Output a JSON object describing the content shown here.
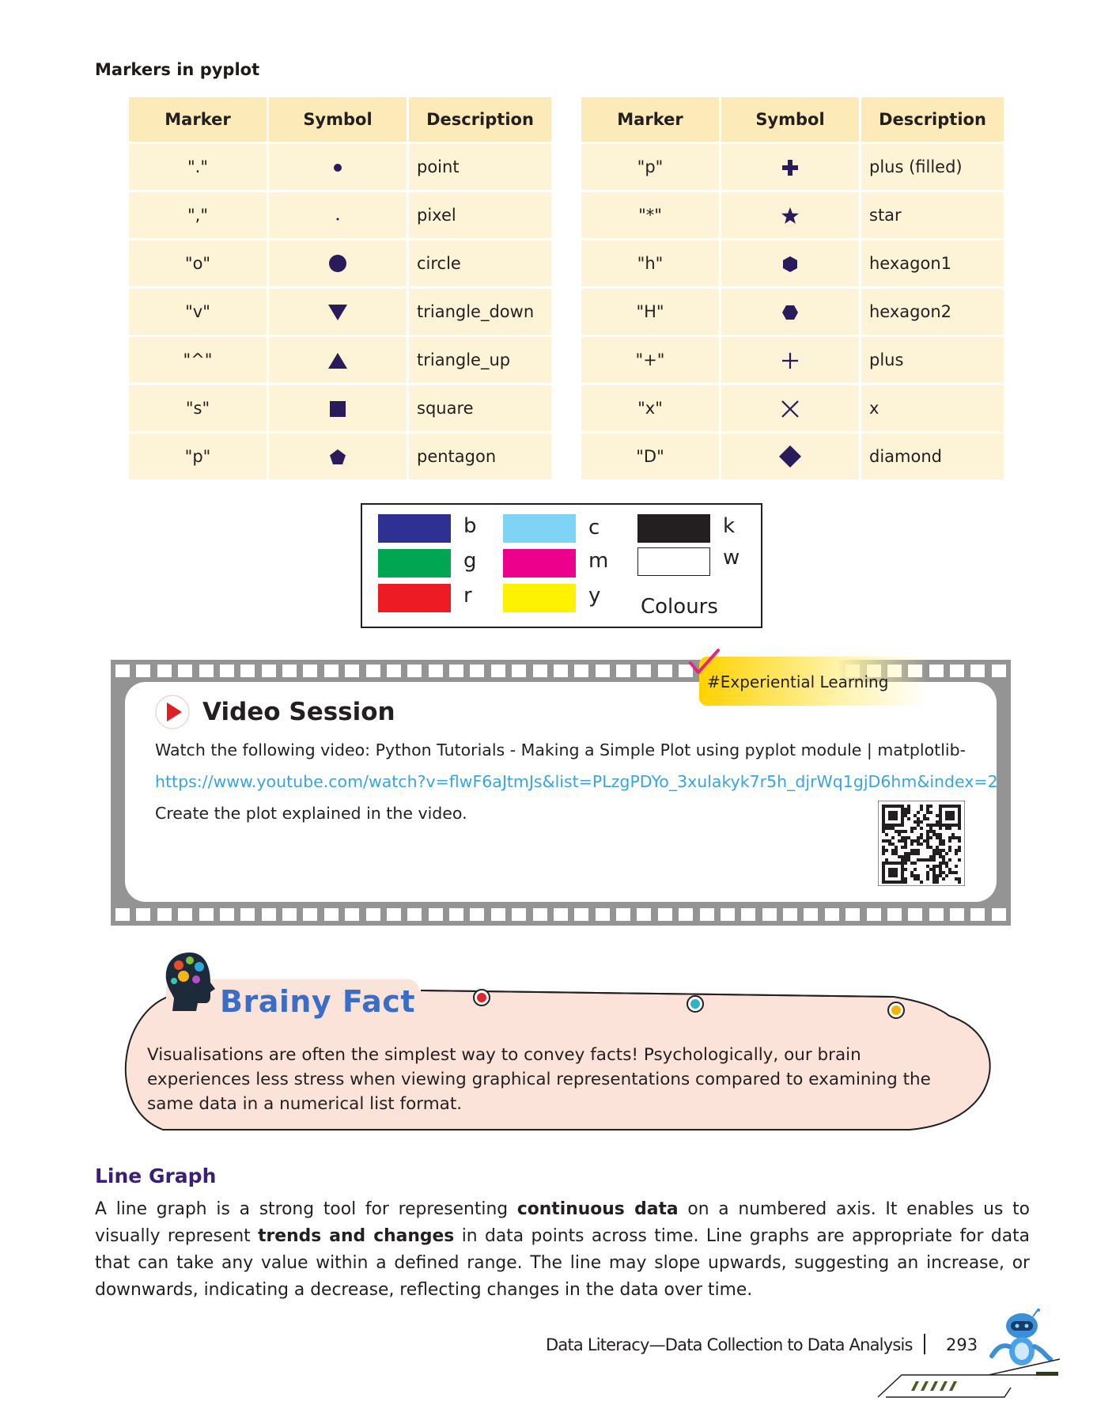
{
  "section_title": "Markers in pyplot",
  "table_headers": {
    "marker": "Marker",
    "symbol": "Symbol",
    "description": "Description"
  },
  "left_table": [
    {
      "marker": "\".\"",
      "symbol": "point-icon",
      "description": "point"
    },
    {
      "marker": "\",\"",
      "symbol": "pixel-icon",
      "description": "pixel"
    },
    {
      "marker": "\"o\"",
      "symbol": "circle-icon",
      "description": "circle"
    },
    {
      "marker": "\"v\"",
      "symbol": "triangle-down-icon",
      "description": "triangle_down"
    },
    {
      "marker": "\"^\"",
      "symbol": "triangle-up-icon",
      "description": "triangle_up"
    },
    {
      "marker": "\"s\"",
      "symbol": "square-icon",
      "description": "square"
    },
    {
      "marker": "\"p\"",
      "symbol": "pentagon-icon",
      "description": "pentagon"
    }
  ],
  "right_table": [
    {
      "marker": "\"p\"",
      "symbol": "plus-filled-icon",
      "description": "plus (filled)"
    },
    {
      "marker": "\"*\"",
      "symbol": "star-icon",
      "description": "star"
    },
    {
      "marker": "\"h\"",
      "symbol": "hexagon1-icon",
      "description": "hexagon1"
    },
    {
      "marker": "\"H\"",
      "symbol": "hexagon2-icon",
      "description": "hexagon2"
    },
    {
      "marker": "\"+\"",
      "symbol": "plus-icon",
      "description": "plus"
    },
    {
      "marker": "\"x\"",
      "symbol": "x-icon",
      "description": "x"
    },
    {
      "marker": "\"D\"",
      "symbol": "diamond-icon",
      "description": "diamond"
    }
  ],
  "colours": {
    "caption": "Colours",
    "items": [
      {
        "code": "b",
        "hex": "#2e3192"
      },
      {
        "code": "g",
        "hex": "#00a651"
      },
      {
        "code": "r",
        "hex": "#ed1c24"
      },
      {
        "code": "c",
        "hex": "#7fd4f5"
      },
      {
        "code": "m",
        "hex": "#ec008c"
      },
      {
        "code": "y",
        "hex": "#fff200"
      },
      {
        "code": "k",
        "hex": "#231f20"
      },
      {
        "code": "w",
        "hex": "#ffffff"
      }
    ]
  },
  "video": {
    "tag": "#Experiential Learning",
    "title": "Video Session",
    "line1": "Watch the following video: Python Tutorials - Making a Simple Plot using pyplot module | matplotlib-",
    "link": "https://www.youtube.com/watch?v=flwF6aJtmJs&list=PLzgPDYo_3xulakyk7r5h_djrWq1gjD6hm&index=2",
    "line2": "Create the plot explained in the video."
  },
  "brainy_fact": {
    "title": "Brainy Fact",
    "text": "Visualisations are often the simplest way to convey facts! Psychologically, our brain experiences less stress when viewing graphical representations compared to examining the same data in a numerical list format."
  },
  "line_graph": {
    "title": "Line Graph",
    "p1": "A line graph is a strong tool for representing ",
    "b1": "continuous data",
    "p2": " on a numbered axis. It enables us to visually represent ",
    "b2": "trends and changes",
    "p3": " in data points across time. Line graphs are appropriate for data that can take any value within a defined range. The line may slope upwards, suggesting an increase, or downwards, indicating a decrease, reflecting changes in the data over time."
  },
  "footer": {
    "text": "Data Literacy—Data Collection to Data Analysis",
    "page": "293"
  },
  "colors": {
    "purple": "#3b1f75",
    "table_header": "#fcebb8",
    "table_cell": "#fdf3d6",
    "link": "#3aa4dc",
    "brainy_blue": "#3a6ec6",
    "brainy_bg": "#fbe3da"
  }
}
